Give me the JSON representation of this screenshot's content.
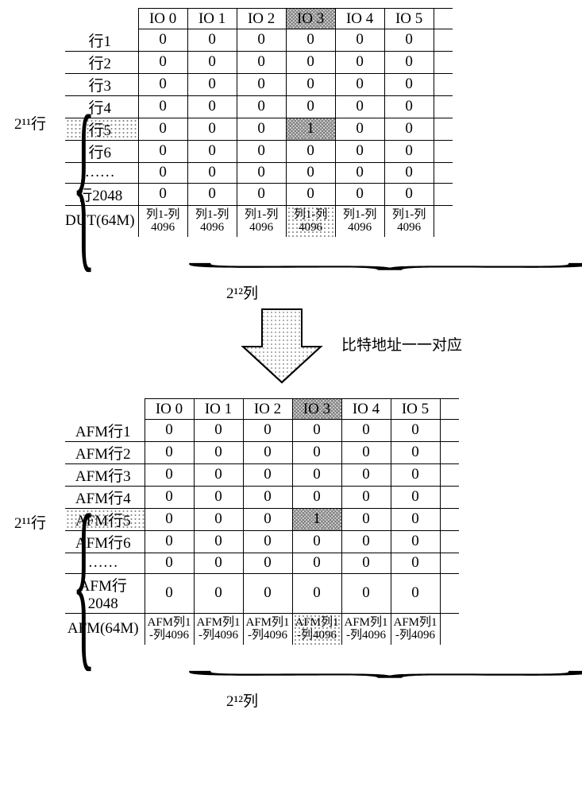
{
  "top": {
    "rowGroupLabel": "2¹¹行",
    "ioHeaders": [
      "IO 0",
      "IO 1",
      "IO 2",
      "IO 3",
      "IO 4",
      "IO 5"
    ],
    "highlightedIoIndex": 3,
    "highlightedRowIndex": 4,
    "rows": [
      {
        "label": "行1",
        "cells": [
          "0",
          "0",
          "0",
          "0",
          "0",
          "0"
        ]
      },
      {
        "label": "行2",
        "cells": [
          "0",
          "0",
          "0",
          "0",
          "0",
          "0"
        ]
      },
      {
        "label": "行3",
        "cells": [
          "0",
          "0",
          "0",
          "0",
          "0",
          "0"
        ]
      },
      {
        "label": "行4",
        "cells": [
          "0",
          "0",
          "0",
          "0",
          "0",
          "0"
        ]
      },
      {
        "label": "行5",
        "cells": [
          "0",
          "0",
          "0",
          "1",
          "0",
          "0"
        ]
      },
      {
        "label": "行6",
        "cells": [
          "0",
          "0",
          "0",
          "0",
          "0",
          "0"
        ]
      },
      {
        "label": "……",
        "cells": [
          "0",
          "0",
          "0",
          "0",
          "0",
          "0"
        ]
      },
      {
        "label": "行2048",
        "cells": [
          "0",
          "0",
          "0",
          "0",
          "0",
          "0"
        ]
      }
    ],
    "footerLabel": "DUT(64M)",
    "footerCells": [
      "列1-列4096",
      "列1-列4096",
      "列1-列4096",
      "列1-列4096",
      "列1-列4096",
      "列1-列4096"
    ],
    "colGroupLabel": "2¹²列"
  },
  "arrow": {
    "text": "比特地址一一对应"
  },
  "bottom": {
    "rowGroupLabel": "2¹¹行",
    "ioHeaders": [
      "IO 0",
      "IO 1",
      "IO 2",
      "IO 3",
      "IO 4",
      "IO 5"
    ],
    "highlightedIoIndex": 3,
    "highlightedRowIndex": 4,
    "rows": [
      {
        "label": "AFM行1",
        "cells": [
          "0",
          "0",
          "0",
          "0",
          "0",
          "0"
        ]
      },
      {
        "label": "AFM行2",
        "cells": [
          "0",
          "0",
          "0",
          "0",
          "0",
          "0"
        ]
      },
      {
        "label": "AFM行3",
        "cells": [
          "0",
          "0",
          "0",
          "0",
          "0",
          "0"
        ]
      },
      {
        "label": "AFM行4",
        "cells": [
          "0",
          "0",
          "0",
          "0",
          "0",
          "0"
        ]
      },
      {
        "label": "AFM行5",
        "cells": [
          "0",
          "0",
          "0",
          "1",
          "0",
          "0"
        ]
      },
      {
        "label": "AFM行6",
        "cells": [
          "0",
          "0",
          "0",
          "0",
          "0",
          "0"
        ]
      },
      {
        "label": "……",
        "cells": [
          "0",
          "0",
          "0",
          "0",
          "0",
          "0"
        ]
      },
      {
        "label": "AFM行2048",
        "cells": [
          "0",
          "0",
          "0",
          "0",
          "0",
          "0"
        ]
      }
    ],
    "footerLabel": "AFM(64M)",
    "footerCells": [
      "AFM列1-列4096",
      "AFM列1-列4096",
      "AFM列1-列4096",
      "AFM列1-列4096",
      "AFM列1-列4096",
      "AFM列1-列4096"
    ],
    "colGroupLabel": "2¹²列"
  },
  "chart_data": {
    "type": "table",
    "description": "Two memory-map tables (DUT 64M and AFM 64M) with 2^11 rows × 2^12 columns across 6 IO groups, showing a single failing bit (value 1) at row 5 / IO 3 mapped one-to-one between DUT and AFM.",
    "tables": [
      {
        "name": "DUT(64M)",
        "row_count": 2048,
        "col_count_per_io": 4096,
        "io_groups": [
          "IO 0",
          "IO 1",
          "IO 2",
          "IO 3",
          "IO 4",
          "IO 5"
        ],
        "shown_rows": [
          "行1",
          "行2",
          "行3",
          "行4",
          "行5",
          "行6",
          "……",
          "行2048"
        ],
        "shown_values": [
          [
            0,
            0,
            0,
            0,
            0,
            0
          ],
          [
            0,
            0,
            0,
            0,
            0,
            0
          ],
          [
            0,
            0,
            0,
            0,
            0,
            0
          ],
          [
            0,
            0,
            0,
            0,
            0,
            0
          ],
          [
            0,
            0,
            0,
            1,
            0,
            0
          ],
          [
            0,
            0,
            0,
            0,
            0,
            0
          ],
          [
            0,
            0,
            0,
            0,
            0,
            0
          ],
          [
            0,
            0,
            0,
            0,
            0,
            0
          ]
        ],
        "highlighted_cell": {
          "row": "行5",
          "io": "IO 3",
          "value": 1
        }
      },
      {
        "name": "AFM(64M)",
        "row_count": 2048,
        "col_count_per_io": 4096,
        "io_groups": [
          "IO 0",
          "IO 1",
          "IO 2",
          "IO 3",
          "IO 4",
          "IO 5"
        ],
        "shown_rows": [
          "AFM行1",
          "AFM行2",
          "AFM行3",
          "AFM行4",
          "AFM行5",
          "AFM行6",
          "……",
          "AFM行2048"
        ],
        "shown_values": [
          [
            0,
            0,
            0,
            0,
            0,
            0
          ],
          [
            0,
            0,
            0,
            0,
            0,
            0
          ],
          [
            0,
            0,
            0,
            0,
            0,
            0
          ],
          [
            0,
            0,
            0,
            0,
            0,
            0
          ],
          [
            0,
            0,
            0,
            1,
            0,
            0
          ],
          [
            0,
            0,
            0,
            0,
            0,
            0
          ],
          [
            0,
            0,
            0,
            0,
            0,
            0
          ],
          [
            0,
            0,
            0,
            0,
            0,
            0
          ]
        ],
        "highlighted_cell": {
          "row": "AFM行5",
          "io": "IO 3",
          "value": 1
        }
      }
    ],
    "mapping_label": "比特地址一一对应",
    "row_axis_label": "2¹¹行",
    "col_axis_label": "2¹²列"
  }
}
